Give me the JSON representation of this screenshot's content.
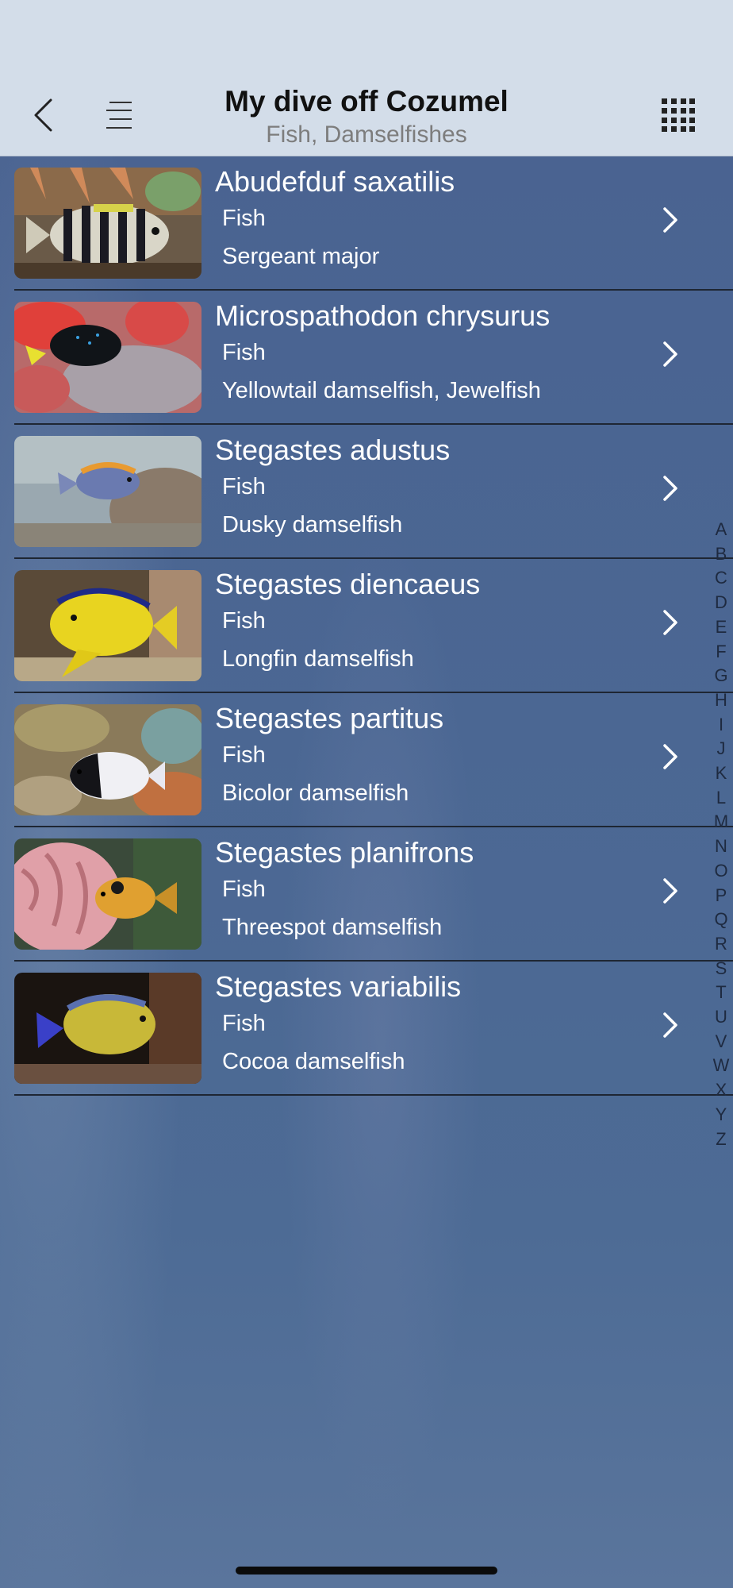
{
  "header": {
    "title": "My dive off Cozumel",
    "subtitle": "Fish, Damselfishes"
  },
  "icons": {
    "back": "chevron-left-icon",
    "menu": "list-icon",
    "grid": "grid-icon",
    "row_disclosure": "chevron-right-icon"
  },
  "species": [
    {
      "scientific": "Abudefduf saxatilis",
      "category": "Fish",
      "common": "Sergeant major"
    },
    {
      "scientific": "Microspathodon chrysurus",
      "category": "Fish",
      "common": "Yellowtail damselfish, Jewelfish"
    },
    {
      "scientific": "Stegastes adustus",
      "category": "Fish",
      "common": "Dusky damselfish"
    },
    {
      "scientific": "Stegastes diencaeus",
      "category": "Fish",
      "common": "Longfin damselfish"
    },
    {
      "scientific": "Stegastes partitus",
      "category": "Fish",
      "common": "Bicolor damselfish"
    },
    {
      "scientific": "Stegastes planifrons",
      "category": "Fish",
      "common": "Threespot damselfish"
    },
    {
      "scientific": "Stegastes variabilis",
      "category": "Fish",
      "common": "Cocoa damselfish"
    }
  ],
  "alphabet_index": [
    "A",
    "B",
    "C",
    "D",
    "E",
    "F",
    "G",
    "H",
    "I",
    "J",
    "K",
    "L",
    "M",
    "N",
    "O",
    "P",
    "Q",
    "R",
    "S",
    "T",
    "U",
    "V",
    "W",
    "X",
    "Y",
    "Z"
  ],
  "colors": {
    "header_bg": "#d3dde9",
    "list_bg": "#4b6793",
    "row_separator": "#1e2633"
  }
}
